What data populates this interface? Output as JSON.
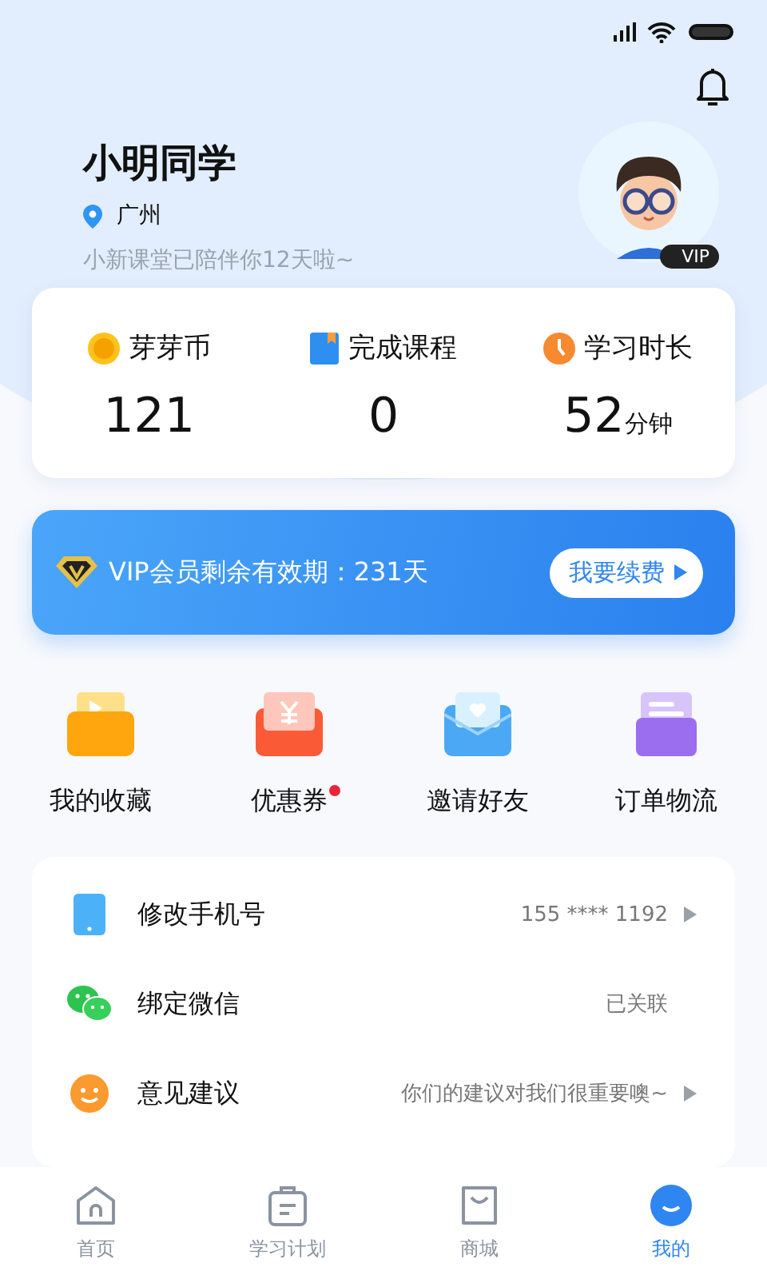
{
  "profile": {
    "name": "小明同学",
    "location": "广州",
    "subtitle": "小新课堂已陪伴你12天啦~",
    "badge": "VIP"
  },
  "stats": [
    {
      "label": "芽芽币",
      "value": "121"
    },
    {
      "label": "完成课程",
      "value": "0"
    },
    {
      "label": "学习时长",
      "value": "52",
      "unit": "分钟"
    }
  ],
  "vip_banner": {
    "text": "VIP会员剩余有效期：231天",
    "button": "我要续费"
  },
  "shortcuts": [
    {
      "label": "我的收藏",
      "badge": false
    },
    {
      "label": "优惠券",
      "badge": true
    },
    {
      "label": "邀请好友",
      "badge": false
    },
    {
      "label": "订单物流",
      "badge": false
    }
  ],
  "settings": [
    {
      "label": "修改手机号",
      "value": "155 **** 1192",
      "arrow": true
    },
    {
      "label": "绑定微信",
      "value": "已关联",
      "arrow": false
    },
    {
      "label": "意见建议",
      "value": "你们的建议对我们很重要噢~",
      "arrow": true
    }
  ],
  "tabs": [
    {
      "label": "首页",
      "selected": false
    },
    {
      "label": "学习计划",
      "selected": false
    },
    {
      "label": "商城",
      "selected": false
    },
    {
      "label": "我的",
      "selected": true
    }
  ]
}
